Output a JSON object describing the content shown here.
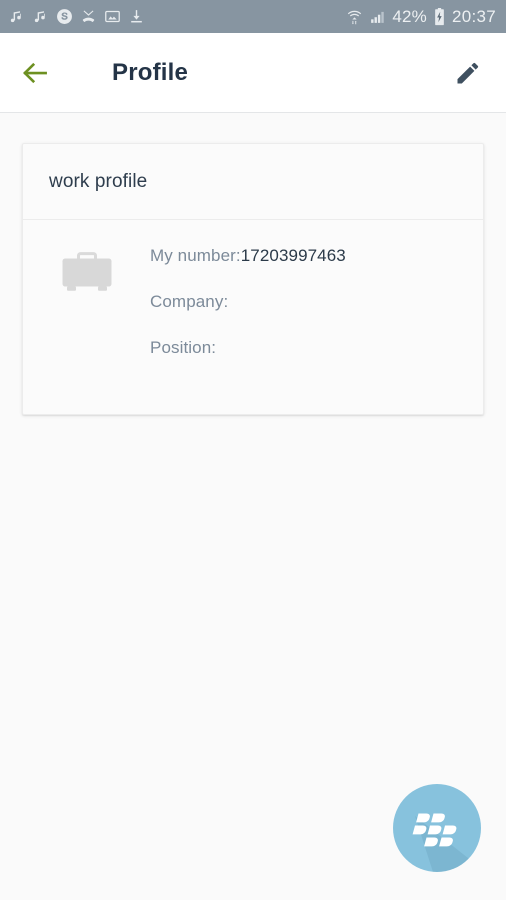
{
  "status_bar": {
    "background_color": "#8795a1",
    "left_icons": [
      "music-note-icon",
      "music-note-icon",
      "skype-icon",
      "missed-call-icon",
      "image-icon",
      "download-icon"
    ],
    "right_icons": [
      "wifi-icon",
      "cellular-signal-icon",
      "battery-charging-icon"
    ],
    "battery_percent": "42%",
    "clock": "20:37"
  },
  "app_bar": {
    "title": "Profile",
    "back_icon": "arrow-left-icon",
    "back_icon_color": "#6d9021",
    "edit_icon": "pencil-icon",
    "edit_icon_color": "#3f5060",
    "background_color": "#ffffff"
  },
  "card": {
    "header_title": "work profile",
    "avatar_icon": "briefcase-icon",
    "avatar_icon_color": "#d8d8d8",
    "fields": [
      {
        "label": "My number:",
        "value": "17203997463"
      },
      {
        "label": "Company:",
        "value": ""
      },
      {
        "label": "Position:",
        "value": ""
      }
    ]
  },
  "fab": {
    "icon": "blackberry-logo-icon",
    "background_color": "#87c2dd",
    "icon_color": "#ffffff"
  },
  "page": {
    "background_color": "#fafafa"
  }
}
